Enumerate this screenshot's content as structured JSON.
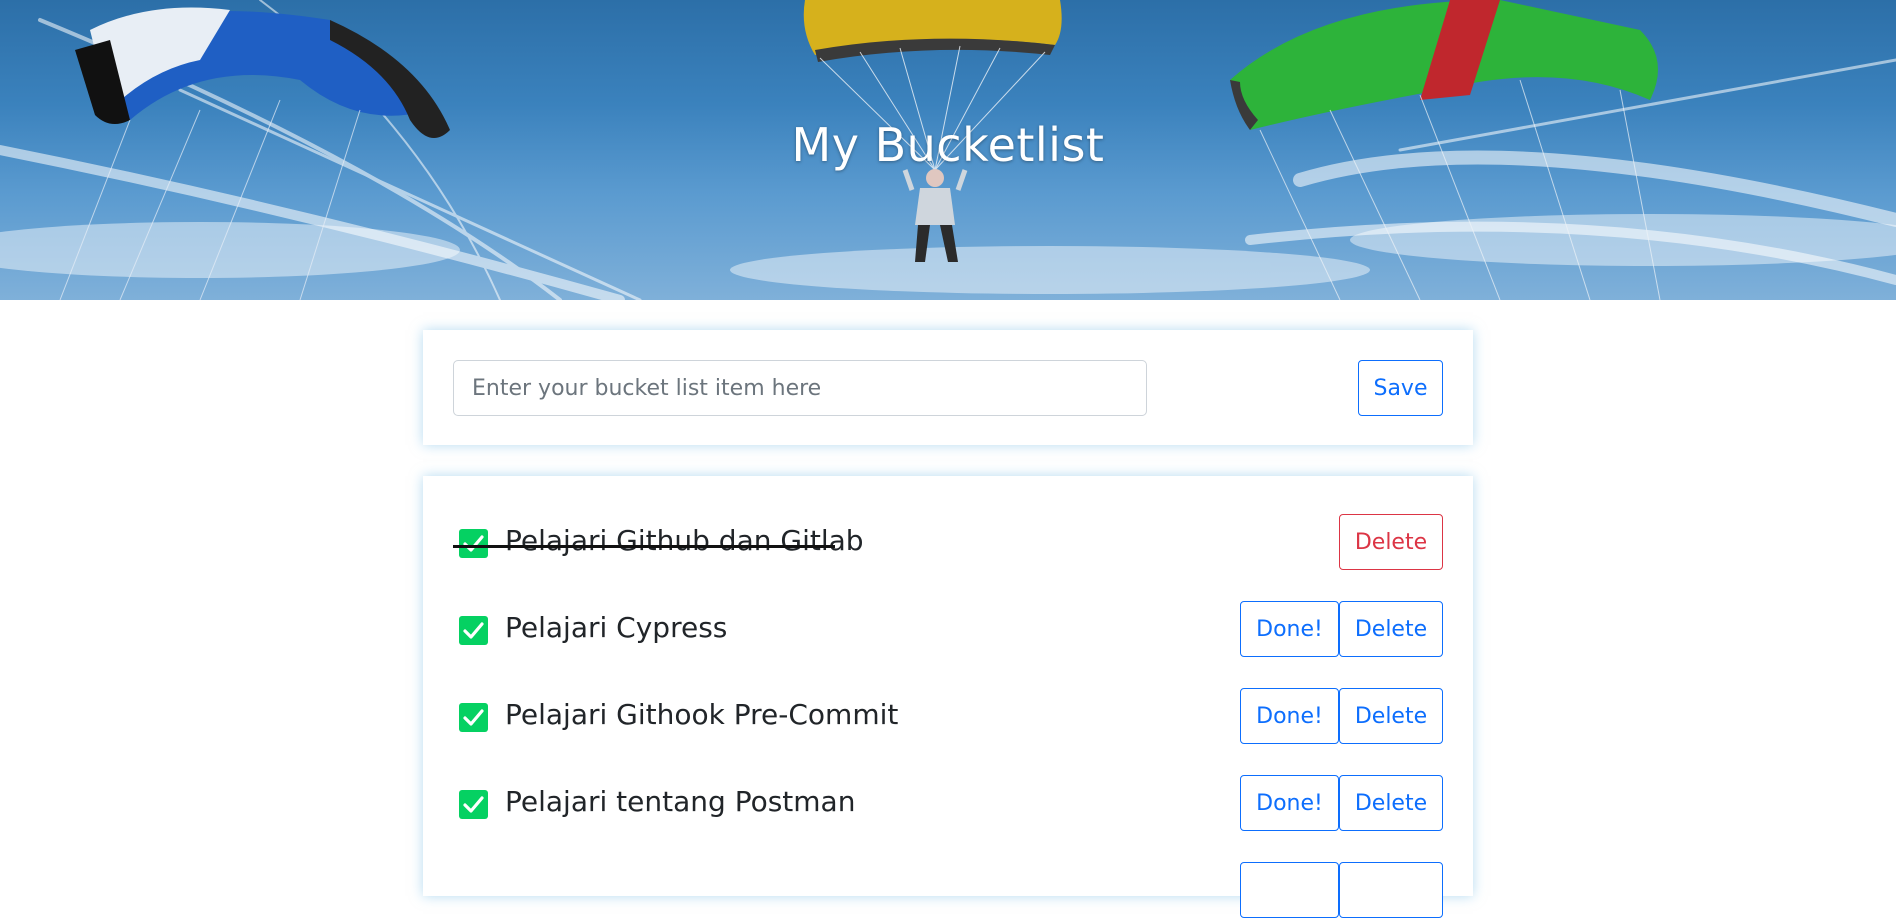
{
  "header": {
    "title": "My Bucketlist"
  },
  "form": {
    "placeholder": "Enter your bucket list item here",
    "value": "",
    "save_label": "Save"
  },
  "items": [
    {
      "text": "Pelajari Github dan Gitlab",
      "completed": true,
      "delete_label": "Delete"
    },
    {
      "text": "Pelajari Cypress",
      "completed": false,
      "done_label": "Done!",
      "delete_label": "Delete"
    },
    {
      "text": "Pelajari Githook Pre-Commit",
      "completed": false,
      "done_label": "Done!",
      "delete_label": "Delete"
    },
    {
      "text": "Pelajari tentang Postman",
      "completed": false,
      "done_label": "Done!",
      "delete_label": "Delete"
    }
  ],
  "colors": {
    "primary": "#0d6efd",
    "danger": "#dc3545",
    "check": "#05d162"
  },
  "icons": {
    "checkbox": "check-icon"
  }
}
